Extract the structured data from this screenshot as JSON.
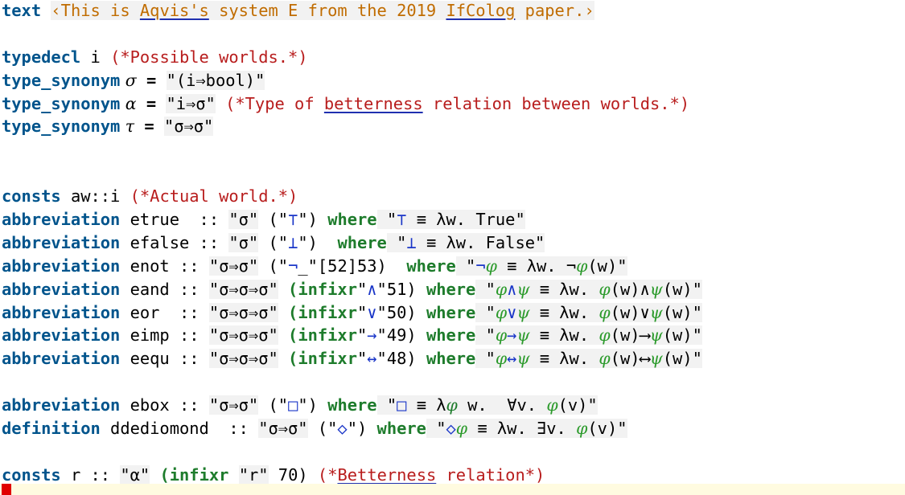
{
  "text_cmd": {
    "kw": "text",
    "open": "‹",
    "p1": "This is ",
    "aqvis": "Aqvis's",
    "p2": " system E from the 2019 ",
    "ifcolog": "IfColog",
    "p3": " paper.",
    "close": "›"
  },
  "typedecl": {
    "kw": "typedecl",
    "name": " i ",
    "comment": "(*Possible worlds.*)"
  },
  "ts1": {
    "kw": "type_synonym",
    "name": " σ",
    "eq": " = ",
    "def": "\"(i⇒bool)\""
  },
  "ts2": {
    "kw": "type_synonym",
    "name": " α",
    "eq": " = ",
    "def": "\"i⇒σ\"",
    "c1": " (*Type of ",
    "c2": "betterness",
    "c3": " relation between worlds.*)"
  },
  "ts3": {
    "kw": "type_synonym",
    "name": " τ",
    "eq": " = ",
    "def": "\"σ⇒σ\""
  },
  "consts_aw": {
    "kw": "consts",
    "name": " aw::i ",
    "comment": "(*Actual world.*)"
  },
  "etrue": {
    "kw": "abbreviation",
    "name": " etrue  :: ",
    "type": "\"σ\"",
    "g1": " (\"",
    "sym": "⊤",
    "g2": "\") ",
    "where": "where",
    "d1": " \"",
    "dsym": "⊤",
    "d2": " ≡ λw. True\""
  },
  "efalse": {
    "kw": "abbreviation",
    "name": " efalse :: ",
    "type": "\"σ\"",
    "g1": " (\"",
    "sym": "⊥",
    "g2": "\")  ",
    "where": "where",
    "d1": " \"",
    "dsym": "⊥",
    "d2": " ≡ λw. False\""
  },
  "enot": {
    "kw": "abbreviation",
    "name": " enot :: ",
    "type": "\"σ⇒σ\"",
    "g1": " (\"",
    "sym": "¬",
    "g2": "_\"[52]53)  ",
    "where": "where",
    "d1": " \"",
    "dsym": "¬",
    "phi": "φ",
    "d2": " ≡ λw. ¬",
    "phi2": "φ",
    "d3": "(w)\""
  },
  "eand": {
    "kw": "abbreviation",
    "name": " eand :: ",
    "type": "\"σ⇒σ⇒σ\"",
    "sp": " ",
    "infixr": "(infixr",
    "q1": "\"",
    "sym": "∧",
    "q2": "\"51) ",
    "where": "where",
    "d1": " \"",
    "phi": "φ",
    "dsym": "∧",
    "psi": "ψ",
    "d2": " ≡ λw. ",
    "phi2": "φ",
    "d3": "(w)∧",
    "psi2": "ψ",
    "d4": "(w)\""
  },
  "eor": {
    "kw": "abbreviation",
    "name": " eor  :: ",
    "type": "\"σ⇒σ⇒σ\"",
    "sp": " ",
    "infixr": "(infixr",
    "q1": "\"",
    "sym": "∨",
    "q2": "\"50) ",
    "where": "where",
    "d1": " \"",
    "phi": "φ",
    "dsym": "∨",
    "psi": "ψ",
    "d2": " ≡ λw. ",
    "phi2": "φ",
    "d3": "(w)∨",
    "psi2": "ψ",
    "d4": "(w)\""
  },
  "eimp": {
    "kw": "abbreviation",
    "name": " eimp :: ",
    "type": "\"σ⇒σ⇒σ\"",
    "sp": " ",
    "infixr": "(infixr",
    "q1": "\"",
    "sym": "→",
    "q2": "\"49) ",
    "where": "where",
    "d1": " \"",
    "phi": "φ",
    "dsym": "→",
    "psi": "ψ",
    "d2": " ≡ λw. ",
    "phi2": "φ",
    "d3": "(w)⟶",
    "psi2": "ψ",
    "d4": "(w)\""
  },
  "eequ": {
    "kw": "abbreviation",
    "name": " eequ :: ",
    "type": "\"σ⇒σ⇒σ\"",
    "sp": " ",
    "infixr": "(infixr",
    "q1": "\"",
    "sym": "↔",
    "q2": "\"48) ",
    "where": "where",
    "d1": " \"",
    "phi": "φ",
    "dsym": "↔",
    "psi": "ψ",
    "d2": " ≡ λw. ",
    "phi2": "φ",
    "d3": "(w)⟷",
    "psi2": "ψ",
    "d4": "(w)\""
  },
  "ebox": {
    "kw": "abbreviation",
    "name": " ebox :: ",
    "type": "\"σ⇒σ\"",
    "g1": " (\"",
    "sym": "□",
    "g2": "\") ",
    "where": "where",
    "d1": " \"",
    "dsym": "□",
    "d2": " ≡ λ",
    "phi": "φ",
    "d3": " w.  ∀v. ",
    "phi2": "φ",
    "d4": "(v)\""
  },
  "ddediomond": {
    "kw": "definition",
    "name": " ddediomond  :: ",
    "type": "\"σ⇒σ\"",
    "g1": " (\"",
    "sym": "◇",
    "g2": "\") ",
    "where": "where",
    "d1": " \"",
    "dsym": "◇",
    "phi": "φ",
    "d2": " ≡ λw. ∃v. ",
    "phi2": "φ",
    "d3": "(v)\""
  },
  "consts_r": {
    "kw": "consts",
    "name": " r :: ",
    "type": "\"α\"",
    "sp": " ",
    "infixr": "(infixr",
    "sp2": " ",
    "sym": "\"r\"",
    "prio": " 70) ",
    "c1": "(*",
    "c2": "Betterness",
    "c3": " relation*)"
  }
}
